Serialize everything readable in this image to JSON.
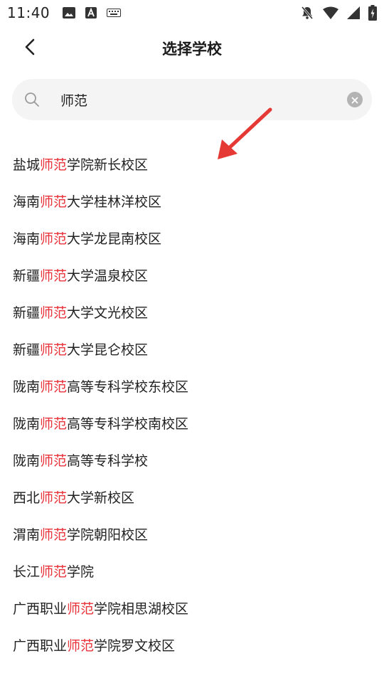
{
  "status_bar": {
    "time": "11:40",
    "left_icons": [
      "image-icon",
      "text-a-icon",
      "keyboard-icon"
    ],
    "right_icons": [
      "bell-off-icon",
      "wifi-icon",
      "signal-icon",
      "battery-icon"
    ]
  },
  "header": {
    "title": "选择学校",
    "back_icon": "chevron-left-icon"
  },
  "search": {
    "value": "师范",
    "search_icon": "search-icon",
    "clear_icon": "clear-icon"
  },
  "highlight_color": "#e8333a",
  "results": [
    {
      "prefix": "盐城",
      "match": "师范",
      "suffix": "学院新长校区"
    },
    {
      "prefix": "海南",
      "match": "师范",
      "suffix": "大学桂林洋校区"
    },
    {
      "prefix": "海南",
      "match": "师范",
      "suffix": "大学龙昆南校区"
    },
    {
      "prefix": "新疆",
      "match": "师范",
      "suffix": "大学温泉校区"
    },
    {
      "prefix": "新疆",
      "match": "师范",
      "suffix": "大学文光校区"
    },
    {
      "prefix": "新疆",
      "match": "师范",
      "suffix": "大学昆仑校区"
    },
    {
      "prefix": "陇南",
      "match": "师范",
      "suffix": "高等专科学校东校区"
    },
    {
      "prefix": "陇南",
      "match": "师范",
      "suffix": "高等专科学校南校区"
    },
    {
      "prefix": "陇南",
      "match": "师范",
      "suffix": "高等专科学校"
    },
    {
      "prefix": "西北",
      "match": "师范",
      "suffix": "大学新校区"
    },
    {
      "prefix": "渭南",
      "match": "师范",
      "suffix": "学院朝阳校区"
    },
    {
      "prefix": "长江",
      "match": "师范",
      "suffix": "学院"
    },
    {
      "prefix": "广西职业",
      "match": "师范",
      "suffix": "学院相思湖校区"
    },
    {
      "prefix": "广西职业",
      "match": "师范",
      "suffix": "学院罗文校区"
    }
  ],
  "annotation_color": "#e53935"
}
